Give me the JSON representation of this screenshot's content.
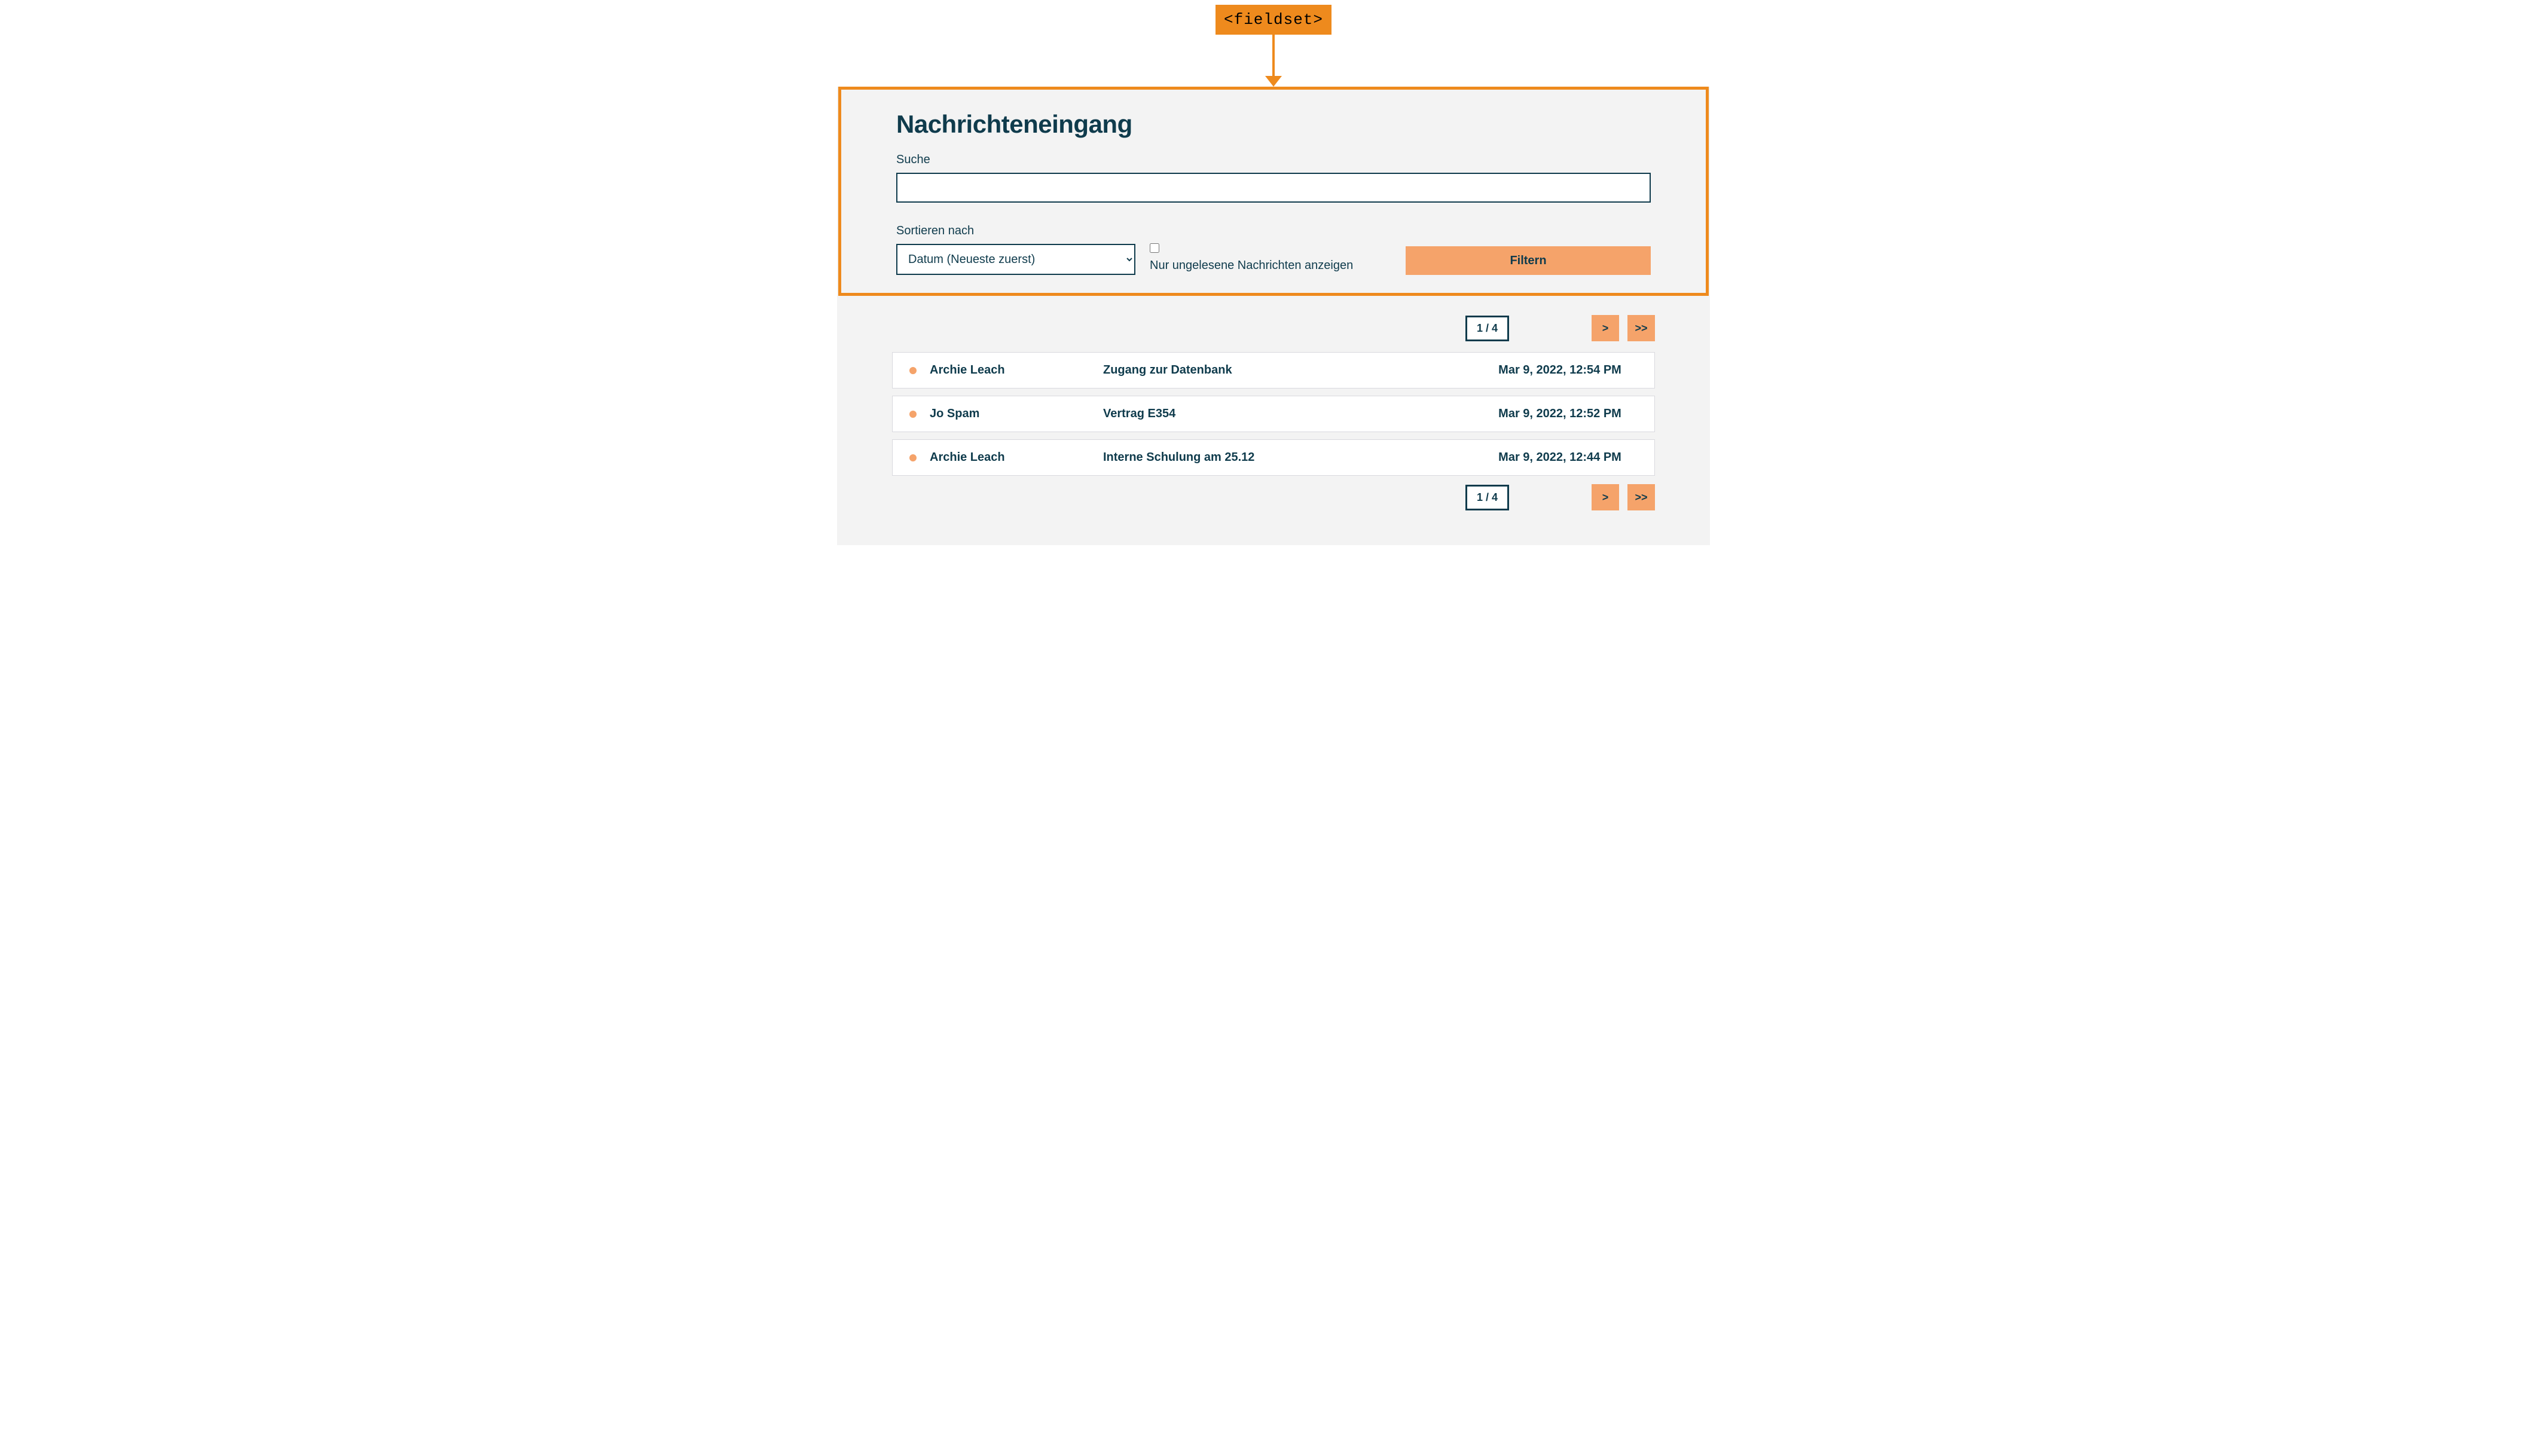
{
  "annotation": {
    "tag_label": "<fieldset>"
  },
  "panel": {
    "title": "Nachrichteneingang",
    "search_label": "Suche",
    "search_value": "",
    "sort_label": "Sortieren nach",
    "sort_selected": "Datum (Neueste zuerst)",
    "unread_only_label": "Nur ungelesene Nachrichten anzeigen",
    "unread_only_checked": false,
    "filter_button": "Filtern"
  },
  "pager": {
    "indicator": "1 / 4",
    "next_label": ">",
    "last_label": ">>"
  },
  "messages": [
    {
      "unread": true,
      "sender": "Archie Leach",
      "subject": "Zugang zur Datenbank",
      "date": "Mar 9, 2022, 12:54 PM"
    },
    {
      "unread": true,
      "sender": "Jo Spam",
      "subject": "Vertrag E354",
      "date": "Mar 9, 2022, 12:52 PM"
    },
    {
      "unread": true,
      "sender": "Archie Leach",
      "subject": "Interne Schulung am 25.12",
      "date": "Mar 9, 2022, 12:44 PM"
    }
  ]
}
